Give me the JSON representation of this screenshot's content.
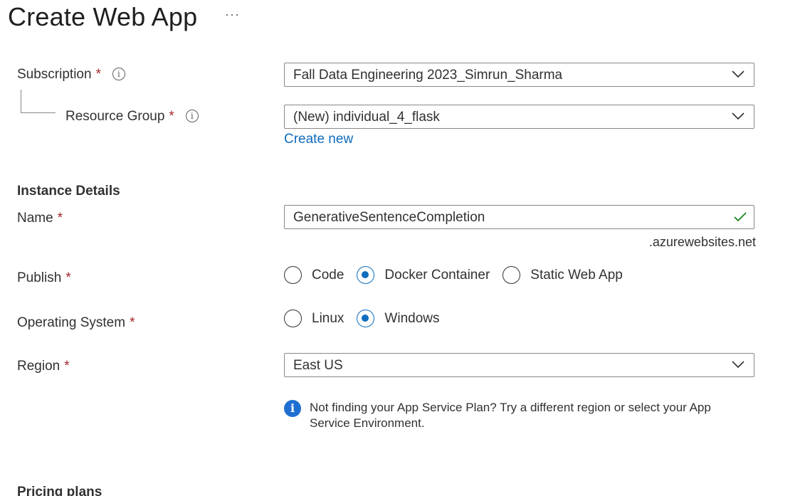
{
  "header": {
    "title": "Create Web App",
    "more_glyph": "···"
  },
  "project": {
    "subscription": {
      "label": "Subscription",
      "required": "*",
      "value": "Fall Data Engineering 2023_Simrun_Sharma"
    },
    "resource_group": {
      "label": "Resource Group",
      "required": "*",
      "value": "(New) individual_4_flask",
      "create_new": "Create new"
    }
  },
  "instance": {
    "heading": "Instance Details",
    "name": {
      "label": "Name",
      "required": "*",
      "value": "GenerativeSentenceCompletion",
      "suffix": ".azurewebsites.net"
    },
    "publish": {
      "label": "Publish",
      "required": "*",
      "options": [
        "Code",
        "Docker Container",
        "Static Web App"
      ],
      "selected": "Docker Container"
    },
    "os": {
      "label": "Operating System",
      "required": "*",
      "options": [
        "Linux",
        "Windows"
      ],
      "selected": "Windows"
    },
    "region": {
      "label": "Region",
      "required": "*",
      "value": "East US"
    },
    "notice": "Not finding your App Service Plan? Try a different region or select your App Service Environment."
  },
  "pricing": {
    "heading": "Pricing plans"
  },
  "colors": {
    "accent": "#0f6cbd",
    "required": "#a4262c",
    "valid": "#107c10",
    "info": "#1f6fd1"
  },
  "icons": {
    "info": "info-circle-icon",
    "chevron": "chevron-down-icon",
    "check": "checkmark-icon",
    "notice": "info-filled-icon"
  }
}
